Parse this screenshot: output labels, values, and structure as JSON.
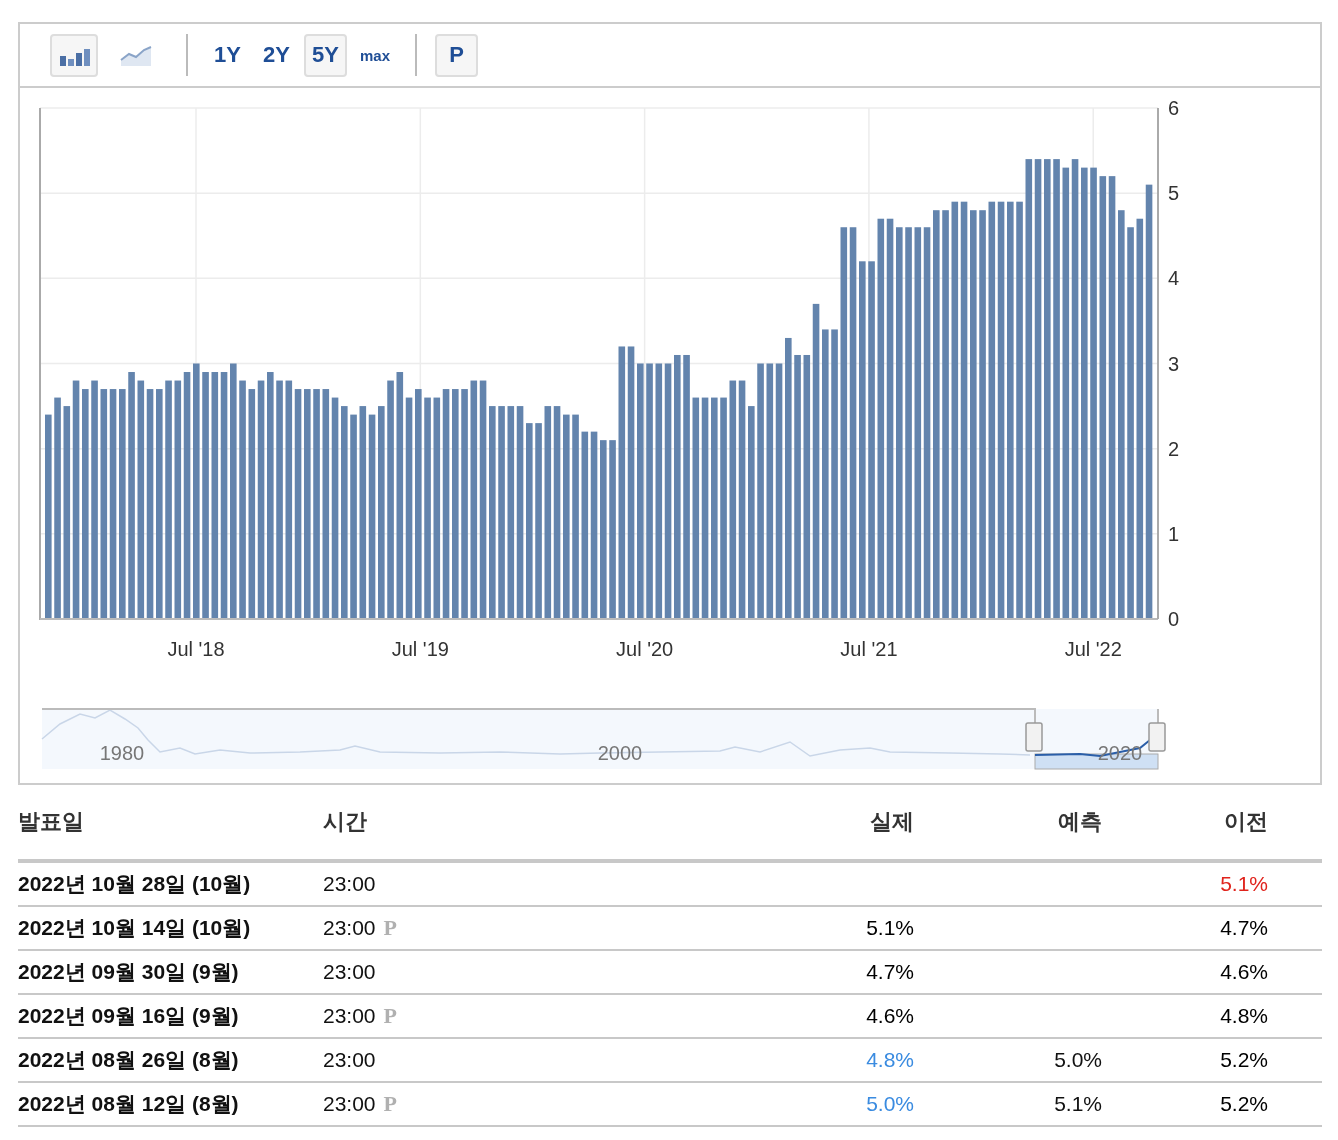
{
  "toolbar": {
    "chart_types": [
      {
        "kind": "bar",
        "selected": true
      },
      {
        "kind": "line",
        "selected": false
      }
    ],
    "ranges": [
      {
        "label": "1Y",
        "selected": false
      },
      {
        "label": "2Y",
        "selected": false
      },
      {
        "label": "5Y",
        "selected": true
      },
      {
        "label": "max",
        "selected": false
      }
    ],
    "preliminary_toggle": {
      "label": "P",
      "on": true
    }
  },
  "chart": {
    "x_axis_labels": [
      "Jul '18",
      "Jul '19",
      "Jul '20",
      "Jul '21",
      "Jul '22"
    ],
    "chart_data": {
      "type": "bar",
      "ylim": [
        0,
        6
      ],
      "yticks": [
        0,
        1,
        2,
        3,
        4,
        5,
        6
      ],
      "grid": true,
      "values": [
        2.4,
        2.6,
        2.5,
        2.8,
        2.7,
        2.8,
        2.7,
        2.7,
        2.7,
        2.9,
        2.8,
        2.7,
        2.7,
        2.8,
        2.8,
        2.9,
        3.0,
        2.9,
        2.9,
        2.9,
        3.0,
        2.8,
        2.7,
        2.8,
        2.9,
        2.8,
        2.8,
        2.7,
        2.7,
        2.7,
        2.7,
        2.6,
        2.5,
        2.4,
        2.5,
        2.4,
        2.5,
        2.8,
        2.9,
        2.6,
        2.7,
        2.6,
        2.6,
        2.7,
        2.7,
        2.7,
        2.8,
        2.8,
        2.5,
        2.5,
        2.5,
        2.5,
        2.3,
        2.3,
        2.5,
        2.5,
        2.4,
        2.4,
        2.2,
        2.2,
        2.1,
        2.1,
        3.2,
        3.2,
        3.0,
        3.0,
        3.0,
        3.0,
        3.1,
        3.1,
        2.6,
        2.6,
        2.6,
        2.6,
        2.8,
        2.8,
        2.5,
        3.0,
        3.0,
        3.0,
        3.3,
        3.1,
        3.1,
        3.7,
        3.4,
        3.4,
        4.6,
        4.6,
        4.2,
        4.2,
        4.7,
        4.7,
        4.6,
        4.6,
        4.6,
        4.6,
        4.8,
        4.8,
        4.9,
        4.9,
        4.8,
        4.8,
        4.9,
        4.9,
        4.9,
        4.9,
        5.4,
        5.4,
        5.4,
        5.4,
        5.3,
        5.4,
        5.3,
        5.3,
        5.2,
        5.2,
        4.8,
        4.6,
        4.7,
        5.1
      ]
    },
    "navigator": {
      "labels": [
        "1980",
        "2000",
        "2020"
      ]
    }
  },
  "table": {
    "columns": [
      "발표일",
      "시간",
      "실제",
      "예측",
      "이전"
    ],
    "rows": [
      {
        "date": "2022년 10월 28일 (10월)",
        "time": "23:00",
        "previous": {
          "text": "5.1%",
          "color": "#e0231c"
        }
      },
      {
        "date": "2022년 10월 14일 (10월)",
        "time": "23:00",
        "mark": "P",
        "actual": {
          "text": "5.1%",
          "color": "#000000"
        },
        "previous": {
          "text": "4.7%",
          "color": "#000000"
        }
      },
      {
        "date": "2022년 09월 30일 (9월)",
        "time": "23:00",
        "actual": {
          "text": "4.7%",
          "color": "#000000"
        },
        "previous": {
          "text": "4.6%",
          "color": "#000000"
        }
      },
      {
        "date": "2022년 09월 16일 (9월)",
        "time": "23:00",
        "mark": "P",
        "actual": {
          "text": "4.6%",
          "color": "#000000"
        },
        "previous": {
          "text": "4.8%",
          "color": "#000000"
        }
      },
      {
        "date": "2022년 08월 26일 (8월)",
        "time": "23:00",
        "actual": {
          "text": "4.8%",
          "color": "#3a8be0"
        },
        "forecast": "5.0%",
        "previous": {
          "text": "5.2%",
          "color": "#000000"
        }
      },
      {
        "date": "2022년 08월 12일 (8월)",
        "time": "23:00",
        "mark": "P",
        "actual": {
          "text": "5.0%",
          "color": "#3a8be0"
        },
        "forecast": "5.1%",
        "previous": {
          "text": "5.2%",
          "color": "#000000"
        }
      }
    ]
  }
}
